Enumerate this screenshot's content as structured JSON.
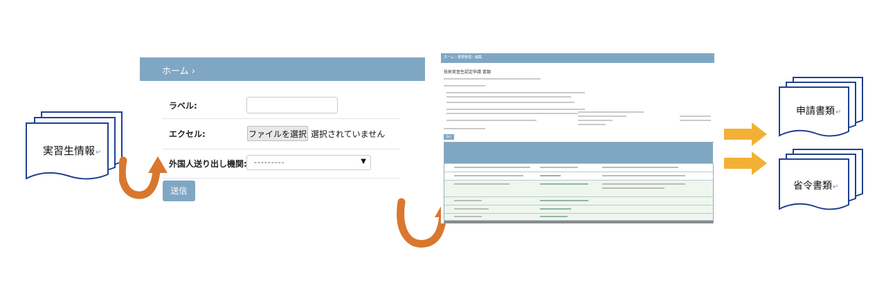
{
  "left_doc": {
    "label": "実習生情報"
  },
  "form": {
    "breadcrumb": "ホーム",
    "label_field": "ラベル:",
    "excel_field": "エクセル:",
    "file_button": "ファイルを選択",
    "file_status": "選択されていません",
    "org_field": "外国人送り出し機関:",
    "org_select_value": "---------",
    "submit": "送信"
  },
  "doc_screenshot": {
    "header_text": "ホーム › 書類管理 › 編集",
    "title": "技術実習生認定申請 書類"
  },
  "right_docs": [
    {
      "label": "申請書類"
    },
    {
      "label": "省令書類"
    }
  ],
  "colors": {
    "accent_blue": "#7fa7c4",
    "doc_border": "#1f3f8f",
    "arrow_yellow": "#f2b134",
    "curve_orange": "#d9772e"
  }
}
